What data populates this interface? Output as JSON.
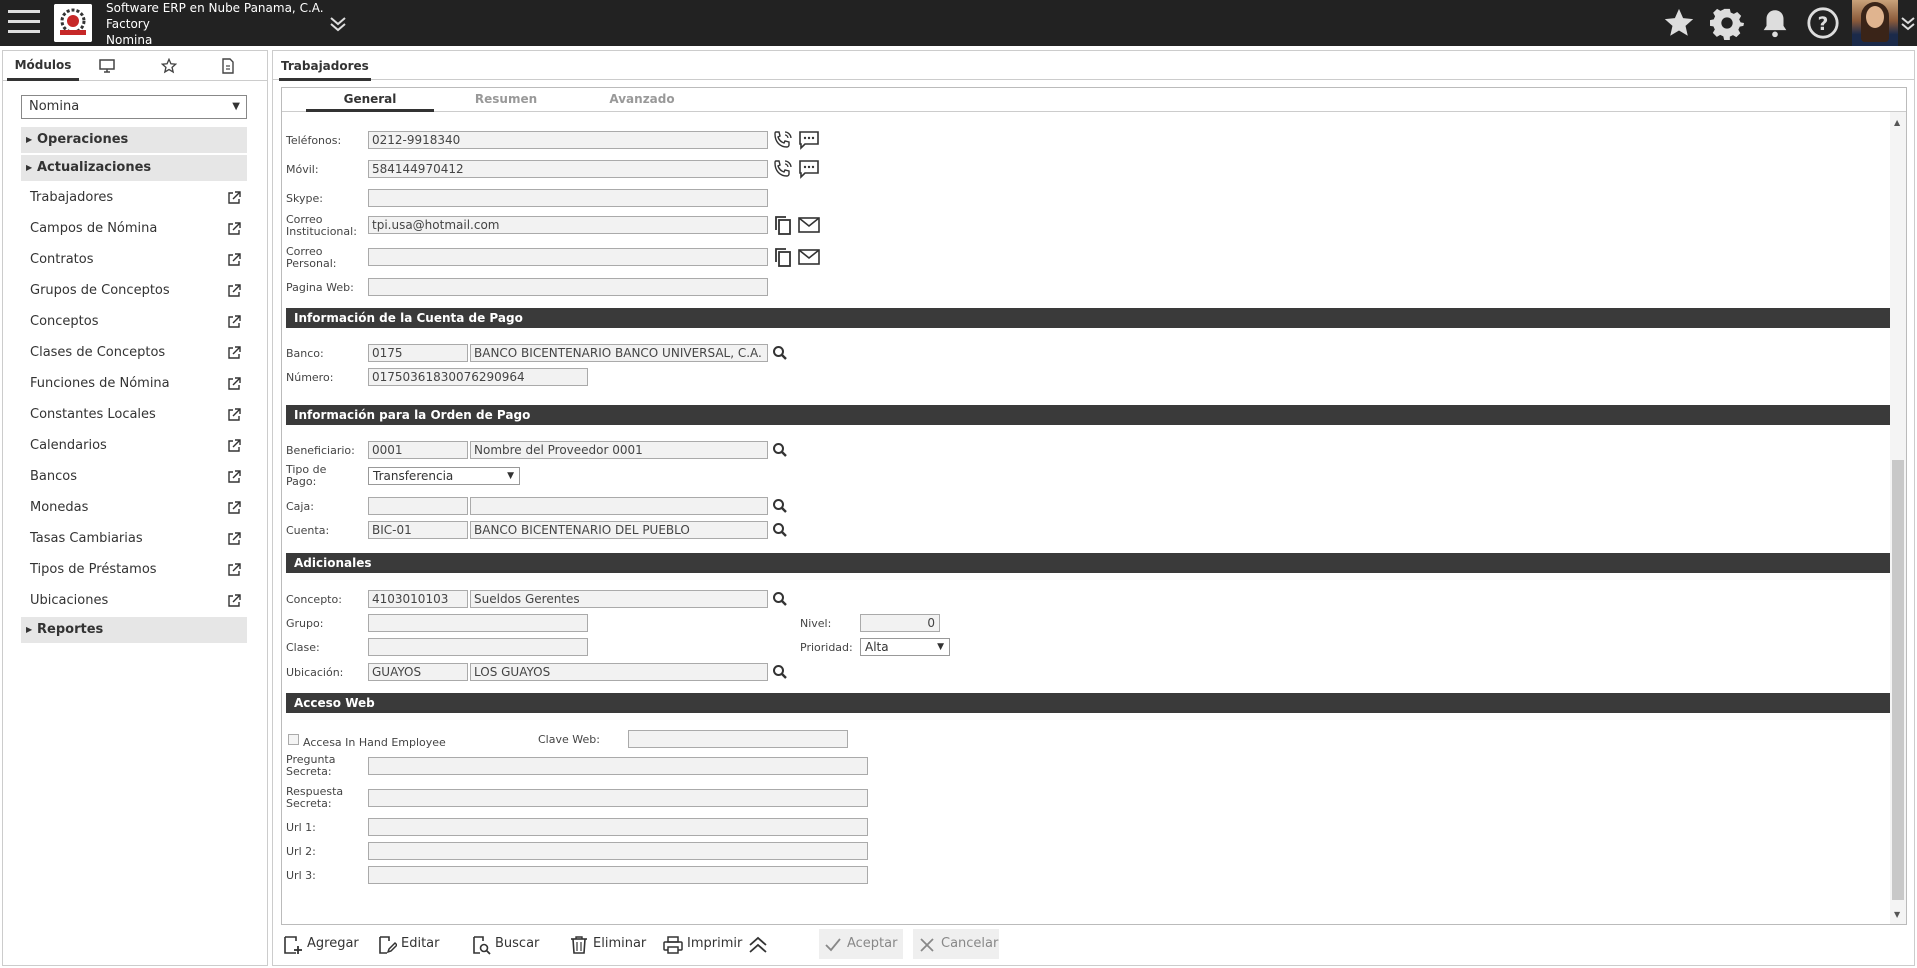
{
  "header": {
    "company_line1": "Software ERP en Nube Panama, C.A.",
    "company_line2": "Factory",
    "company_line3": "Nomina"
  },
  "icons": {
    "menu": "hamburger-icon",
    "expand": "double-chevron-down-icon",
    "favorite": "star-icon",
    "settings": "gear-icon",
    "notifications": "bell-icon",
    "help": "help-circle-icon"
  },
  "left_panel": {
    "tab_label": "Módulos",
    "module_selected": "Nomina",
    "groups": {
      "operaciones": "Operaciones",
      "actualizaciones": "Actualizaciones",
      "reportes": "Reportes"
    },
    "items": [
      "Trabajadores",
      "Campos de Nómina",
      "Contratos",
      "Grupos de Conceptos",
      "Conceptos",
      "Clases de Conceptos",
      "Funciones de Nómina",
      "Constantes Locales",
      "Calendarios",
      "Bancos",
      "Monedas",
      "Tasas Cambiarias",
      "Tipos de Préstamos",
      "Ubicaciones"
    ]
  },
  "main": {
    "tab_label": "Trabajadores",
    "subtabs": [
      "General",
      "Resumen",
      "Avanzado"
    ]
  },
  "form": {
    "telefonos": {
      "label": "Teléfonos:",
      "value": "0212-9918340"
    },
    "movil": {
      "label": "Móvil:",
      "value": "584144970412"
    },
    "skype": {
      "label": "Skype:",
      "value": ""
    },
    "correo_inst": {
      "label1": "Correo",
      "label2": "Institucional:",
      "value": "tpi.usa@hotmail.com"
    },
    "correo_pers": {
      "label1": "Correo",
      "label2": "Personal:",
      "value": ""
    },
    "pagina_web": {
      "label": "Pagina Web:",
      "value": ""
    },
    "section_cuenta": "Información de la Cuenta de Pago",
    "banco": {
      "label": "Banco:",
      "code": "0175",
      "name": "BANCO BICENTENARIO BANCO UNIVERSAL, C.A."
    },
    "numero": {
      "label": "Número:",
      "value": "01750361830076290964"
    },
    "section_orden": "Información para la Orden de Pago",
    "beneficiario": {
      "label": "Beneficiario:",
      "code": "0001",
      "name": "Nombre del Proveedor 0001"
    },
    "tipo_pago": {
      "label1": "Tipo de",
      "label2": "Pago:",
      "value": "Transferencia"
    },
    "caja": {
      "label": "Caja:",
      "code": "",
      "name": ""
    },
    "cuenta": {
      "label": "Cuenta:",
      "code": "BIC-01",
      "name": "BANCO BICENTENARIO DEL PUEBLO"
    },
    "section_adicionales": "Adicionales",
    "concepto": {
      "label": "Concepto:",
      "code": "4103010103",
      "name": "Sueldos Gerentes"
    },
    "grupo": {
      "label": "Grupo:",
      "value": ""
    },
    "clase": {
      "label": "Clase:",
      "value": ""
    },
    "ubicacion": {
      "label": "Ubicación:",
      "code": "GUAYOS",
      "name": "LOS GUAYOS"
    },
    "nivel": {
      "label": "Nivel:",
      "value": "0"
    },
    "prioridad": {
      "label": "Prioridad:",
      "value": "Alta"
    },
    "section_acceso": "Acceso Web",
    "accesa": {
      "label": "Accesa In Hand Employee",
      "checked": false
    },
    "clave_web": {
      "label": "Clave Web:",
      "value": ""
    },
    "pregunta": {
      "label1": "Pregunta",
      "label2": "Secreta:",
      "value": ""
    },
    "respuesta": {
      "label1": "Respuesta",
      "label2": "Secreta:",
      "value": ""
    },
    "url1": {
      "label": "Url 1:",
      "value": ""
    },
    "url2": {
      "label": "Url 2:",
      "value": ""
    },
    "url3": {
      "label": "Url 3:",
      "value": ""
    }
  },
  "toolbar": {
    "agregar": "Agregar",
    "editar": "Editar",
    "buscar": "Buscar",
    "eliminar": "Eliminar",
    "imprimir": "Imprimir",
    "aceptar": "Aceptar",
    "cancelar": "Cancelar"
  }
}
